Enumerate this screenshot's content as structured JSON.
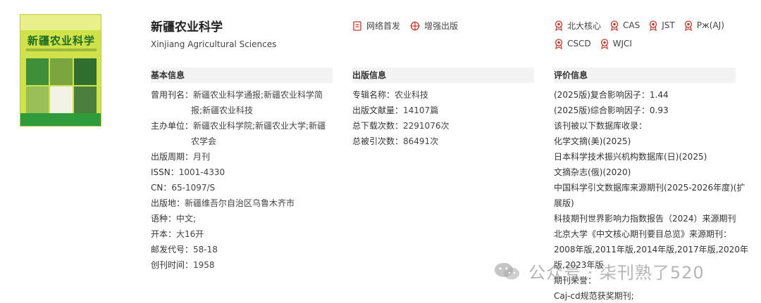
{
  "journal": {
    "title": "新疆农业科学",
    "title_en": "Xinjiang Agricultural Sciences",
    "cover_title": "新疆农业科学"
  },
  "actions": [
    {
      "label": "网络首发",
      "icon": "document-icon"
    },
    {
      "label": "增强出版",
      "icon": "target-icon"
    }
  ],
  "badges": [
    "北大核心",
    "CAS",
    "JST",
    "Pж(AJ)",
    "CSCD",
    "WJCI"
  ],
  "basic": {
    "heading": "基本信息",
    "alt_names_key": "曾用刊名：",
    "alt_names_line1": "新疆农业科学通报;新疆农业科学简",
    "alt_names_line2": "报;新疆农业科技",
    "sponsor_key": "主办单位：",
    "sponsor_line1": "新疆农业科学院;新疆农业大学;新疆",
    "sponsor_line2": "农学会",
    "period_key": "出版周期：",
    "period": "月刊",
    "issn_key": "ISSN：",
    "issn": "1001-4330",
    "cn_key": "CN：",
    "cn": "65-1097/S",
    "place_key": "出版地：",
    "place": "新疆维吾尔自治区乌鲁木齐市",
    "lang_key": "语种：",
    "lang": "中文;",
    "format_key": "开本：",
    "format": "大16开",
    "postal_key": "邮发代号：",
    "postal": "58-18",
    "founded_key": "创刊时间：",
    "founded": "1958"
  },
  "publish": {
    "heading": "出版信息",
    "topic_key": "专辑名称：",
    "topic": "农业科技",
    "count_key": "出版文献量：",
    "count": "14107篇",
    "downloads_key": "总下载次数：",
    "downloads": "2291076次",
    "cites_key": "总被引次数：",
    "cites": "86491次"
  },
  "eval": {
    "heading": "评价信息",
    "if_composite": "(2025版)复合影响因子：1.44",
    "if_general": "(2025版)综合影响因子：0.93",
    "db_intro": "该刊被以下数据库收录：",
    "db1": "化学文摘(美)(2025)",
    "db2": "日本科学技术振兴机构数据库(日)(2025)",
    "db3": "文摘杂志(俄)(2020)",
    "db4_line1": "中国科学引文数据库来源期刊(2025-2026年度)(扩",
    "db4_line2": "展版)",
    "db5": "科技期刊世界影响力指数报告（2024）来源期刊",
    "pku_intro": "北京大学《中文核心期刊要目总览》来源期刊：",
    "pku_line1": "2008年版,2011年版,2014年版,2017年版,2020年",
    "pku_line2": "版,2023年版",
    "honor_key": "期刊荣誉：",
    "honor": "Caj-cd规范获奖期刊;"
  },
  "watermark": {
    "text": "公众号 · 柒刊熟了520"
  },
  "colors": {
    "accent": "#c0392b",
    "section_bg": "#f3f3f3"
  }
}
